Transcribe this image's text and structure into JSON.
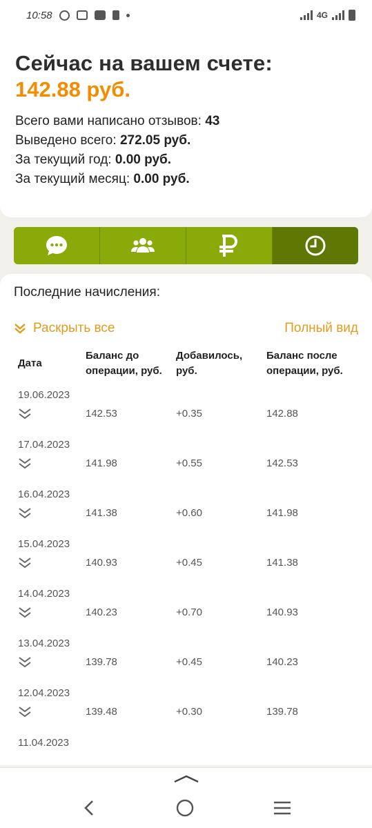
{
  "status_bar": {
    "time": "10:58",
    "network": "4G"
  },
  "account": {
    "heading": "Сейчас на вашем счете:",
    "balance": "142.88 руб.",
    "stats": [
      {
        "label": "Всего вами написано отзывов:",
        "value": "43"
      },
      {
        "label": "Выведено всего:",
        "value": "272.05 руб."
      },
      {
        "label": "За текущий год:",
        "value": "0.00 руб."
      },
      {
        "label": "За текущий месяц:",
        "value": "0.00 руб."
      }
    ]
  },
  "tabs": [
    {
      "icon": "chat-icon",
      "active": false
    },
    {
      "icon": "users-icon",
      "active": false
    },
    {
      "icon": "ruble-icon",
      "active": false
    },
    {
      "icon": "clock-icon",
      "active": true
    }
  ],
  "colors": {
    "accent_orange": "#f28c00",
    "link_orange": "#e39b1c",
    "tab_green": "#8aaa0a",
    "tab_active": "#5f7804"
  },
  "accruals": {
    "title": "Последние начисления:",
    "expand_all": "Раскрыть все",
    "full_view": "Полный вид",
    "columns": [
      "Дата",
      "Баланс до операции, руб.",
      "Добавилось, руб.",
      "Баланс после операции, руб."
    ],
    "rows": [
      {
        "date": "19.06.2023",
        "before": "142.53",
        "added": "+0.35",
        "after": "142.88"
      },
      {
        "date": "17.04.2023",
        "before": "141.98",
        "added": "+0.55",
        "after": "142.53"
      },
      {
        "date": "16.04.2023",
        "before": "141.38",
        "added": "+0.60",
        "after": "141.98"
      },
      {
        "date": "15.04.2023",
        "before": "140.93",
        "added": "+0.45",
        "after": "141.38"
      },
      {
        "date": "14.04.2023",
        "before": "140.23",
        "added": "+0.70",
        "after": "140.93"
      },
      {
        "date": "13.04.2023",
        "before": "139.78",
        "added": "+0.45",
        "after": "140.23"
      },
      {
        "date": "12.04.2023",
        "before": "139.48",
        "added": "+0.30",
        "after": "139.78"
      },
      {
        "date": "11.04.2023",
        "before": "",
        "added": "",
        "after": ""
      }
    ]
  }
}
